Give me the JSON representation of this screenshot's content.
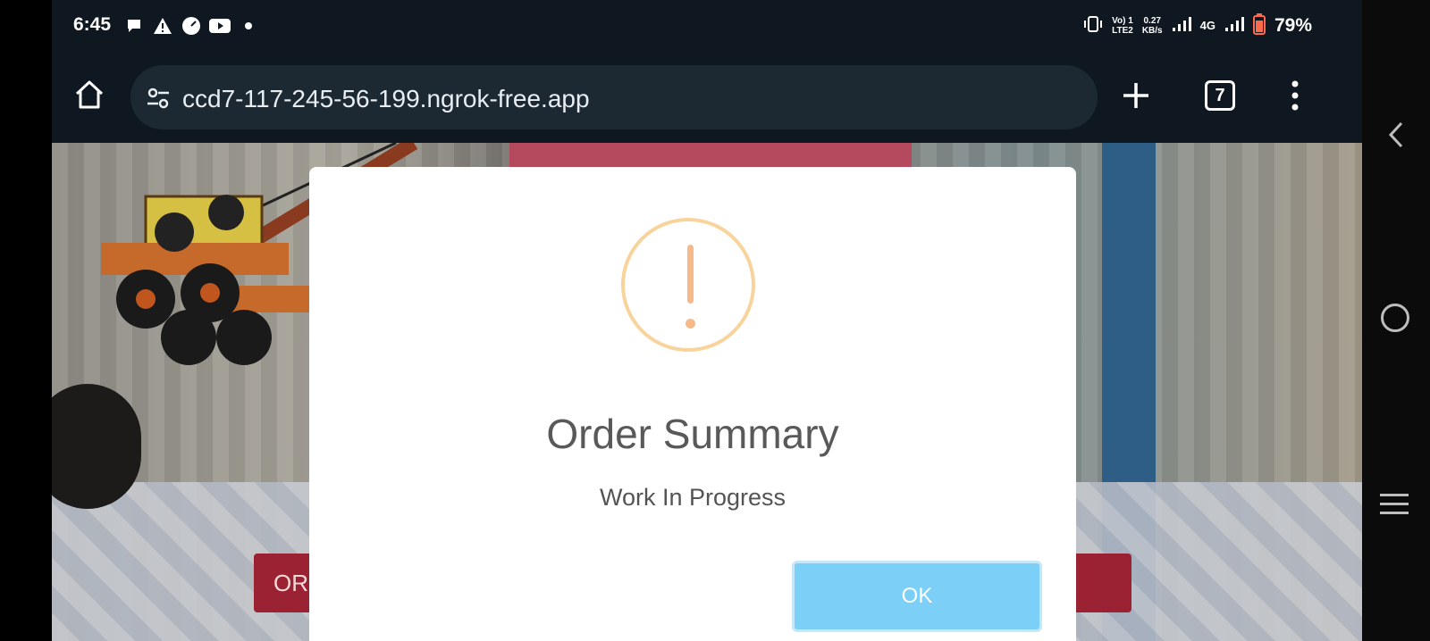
{
  "status_bar": {
    "time": "6:45",
    "network_small_top": "Vo) 1",
    "network_small_bottom": "LTE2",
    "speed_value": "0.27",
    "speed_unit": "KB/s",
    "network_type": "4G",
    "battery": "79%",
    "icons": [
      "chat-icon",
      "warning-icon",
      "speed-icon",
      "youtube-icon",
      "dot-icon",
      "vibrate-icon",
      "signal-icon",
      "signal-icon",
      "battery-icon"
    ]
  },
  "browser": {
    "url": "ccd7-117-245-56-199.ngrok-free.app",
    "tab_count": "7",
    "icons": [
      "home-icon",
      "tune-icon",
      "plus-icon",
      "tabs-icon",
      "more-icon"
    ]
  },
  "page": {
    "left_button_label": "OR"
  },
  "modal": {
    "title": "Order Summary",
    "message": "Work In Progress",
    "ok_label": "OK",
    "icon": "exclamation-icon",
    "accent_color": "#f8d49c",
    "button_color": "#7ccff6"
  },
  "system_nav": {
    "icons": [
      "back-icon",
      "home-circle-icon",
      "recents-icon"
    ]
  }
}
